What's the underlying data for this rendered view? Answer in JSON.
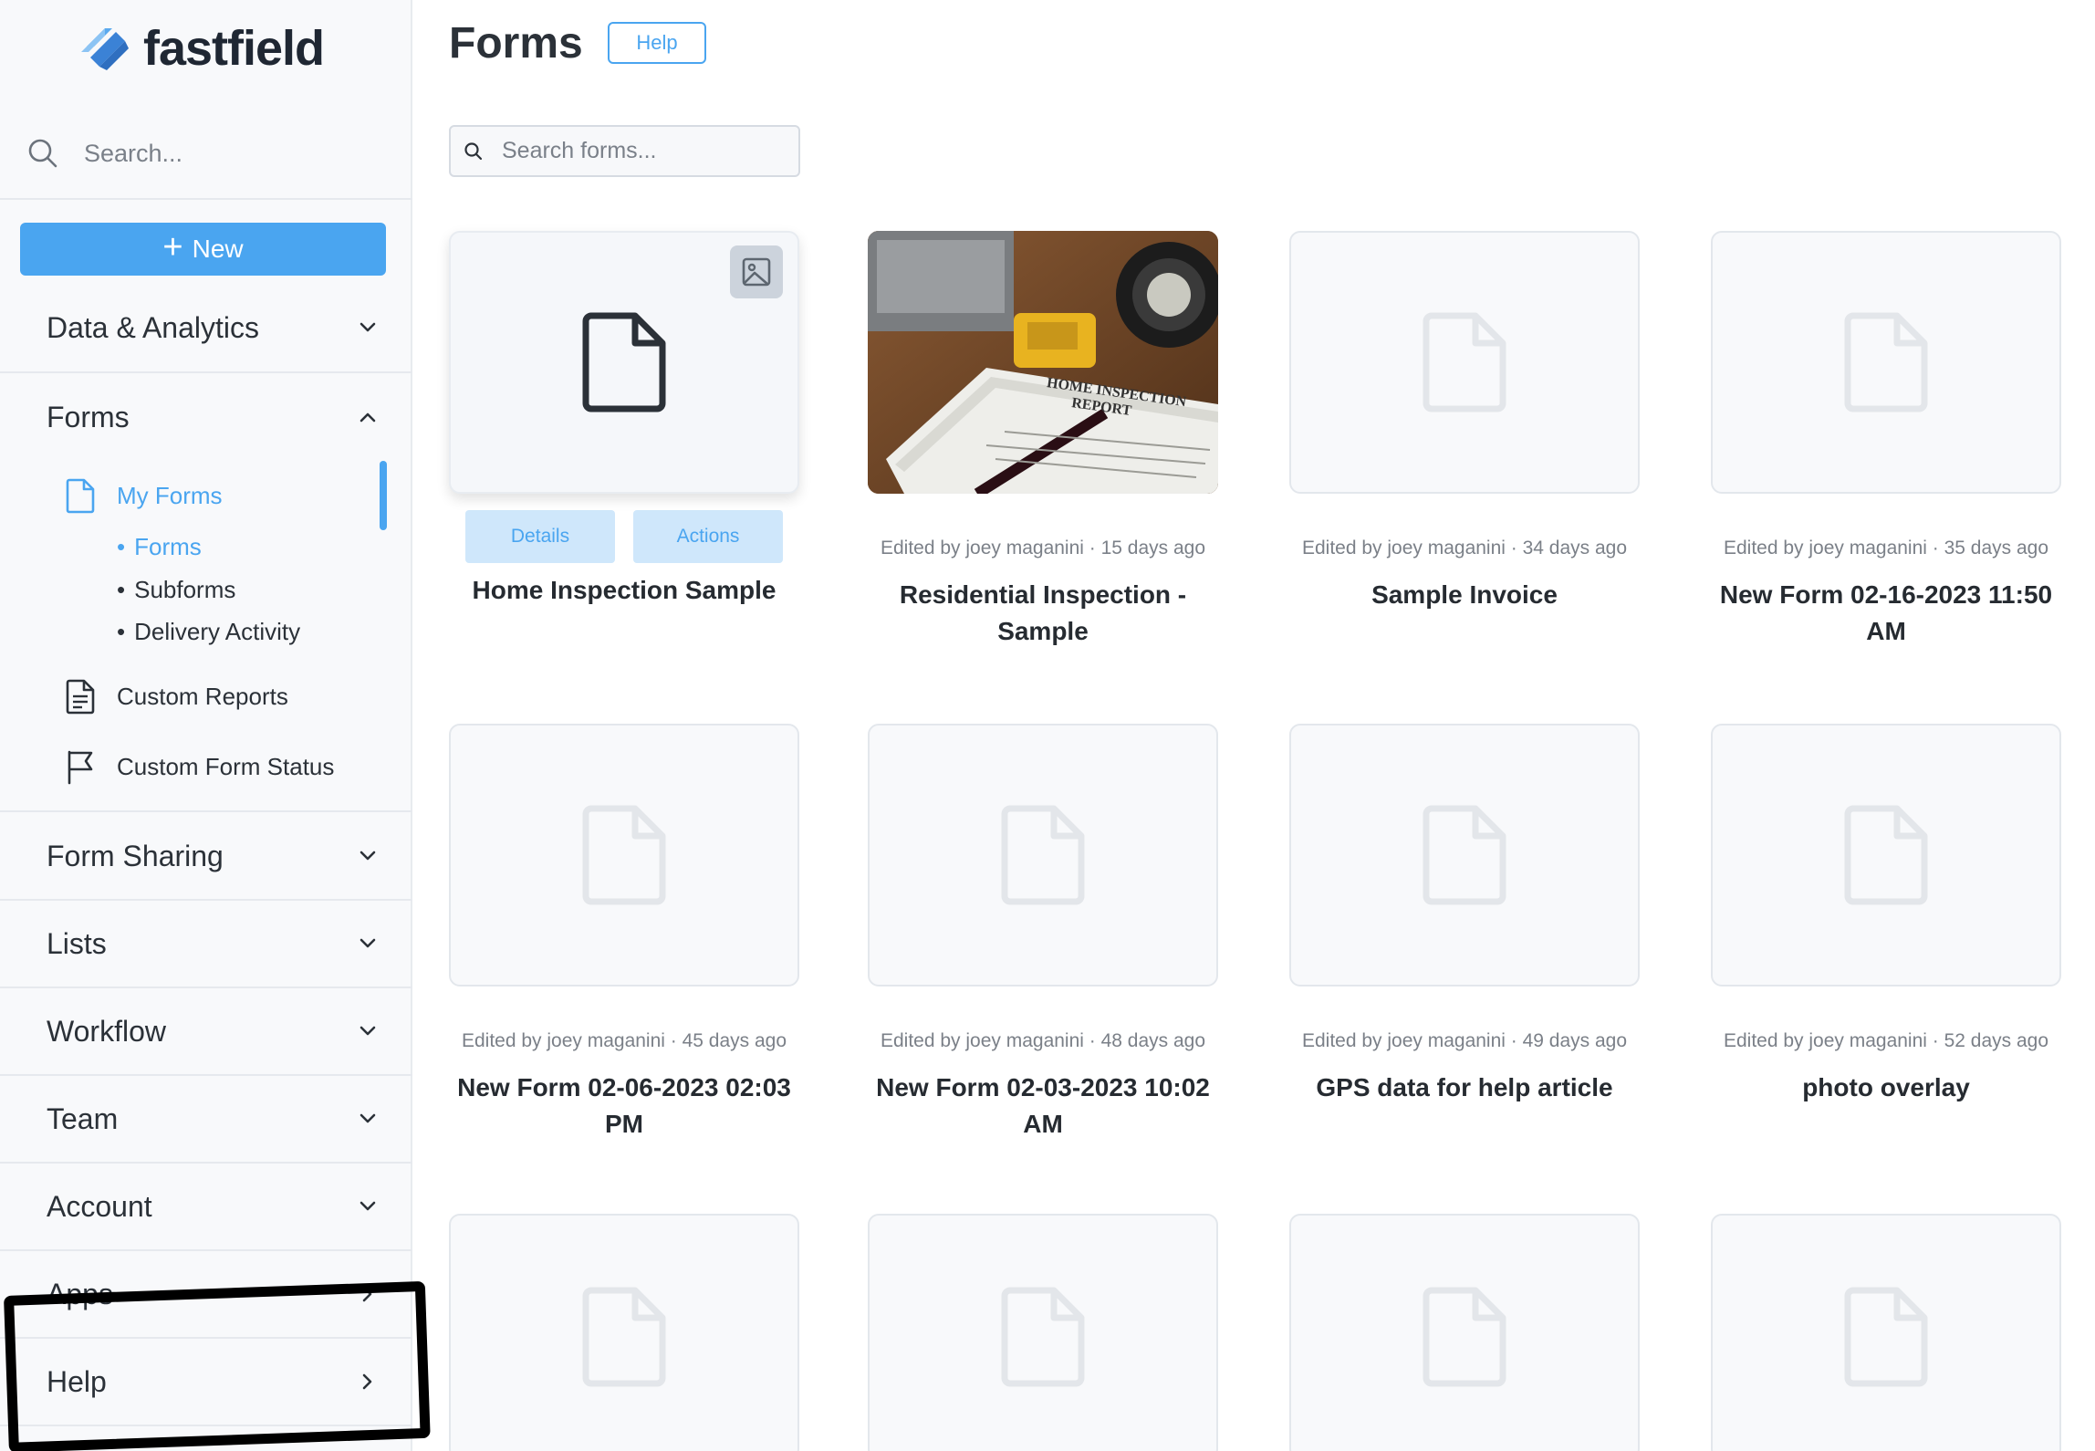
{
  "sidebar": {
    "brand": "fastfield",
    "search_placeholder": "Search...",
    "new_label": "New",
    "sections": {
      "data_analytics": "Data & Analytics",
      "forms": "Forms",
      "form_sharing": "Form Sharing",
      "lists": "Lists",
      "workflow": "Workflow",
      "team": "Team",
      "account": "Account",
      "apps": "Apps",
      "help": "Help"
    },
    "forms_items": {
      "my_forms": "My Forms",
      "forms": "Forms",
      "subforms": "Subforms",
      "delivery_activity": "Delivery Activity",
      "custom_reports": "Custom Reports",
      "custom_form_status": "Custom Form Status"
    },
    "bullet": "•"
  },
  "header": {
    "title": "Forms",
    "help_label": "Help",
    "search_placeholder": "Search forms..."
  },
  "cards": [
    {
      "name": "Home Inspection Sample",
      "meta": "",
      "details_label": "Details",
      "actions_label": "Actions"
    },
    {
      "name": "Residential Inspection - Sample",
      "meta": "Edited by joey maganini · 15 days ago"
    },
    {
      "name": "Sample Invoice",
      "meta": "Edited by joey maganini · 34 days ago"
    },
    {
      "name": "New Form 02-16-2023 11:50 AM",
      "meta": "Edited by joey maganini · 35 days ago"
    },
    {
      "name": "New Form 02-06-2023 02:03 PM",
      "meta": "Edited by joey maganini · 45 days ago"
    },
    {
      "name": "New Form 02-03-2023 10:02 AM",
      "meta": "Edited by joey maganini · 48 days ago"
    },
    {
      "name": "GPS data for help article",
      "meta": "Edited by joey maganini · 49 days ago"
    },
    {
      "name": "photo overlay",
      "meta": "Edited by joey maganini · 52 days ago"
    }
  ],
  "photo_text": {
    "line1": "HOME INSPECTION",
    "line2": "REPORT"
  },
  "colors": {
    "accent": "#4aa5f0",
    "sidebar_bg": "#f8f9fb",
    "logo_blue": "#3b82d6"
  }
}
